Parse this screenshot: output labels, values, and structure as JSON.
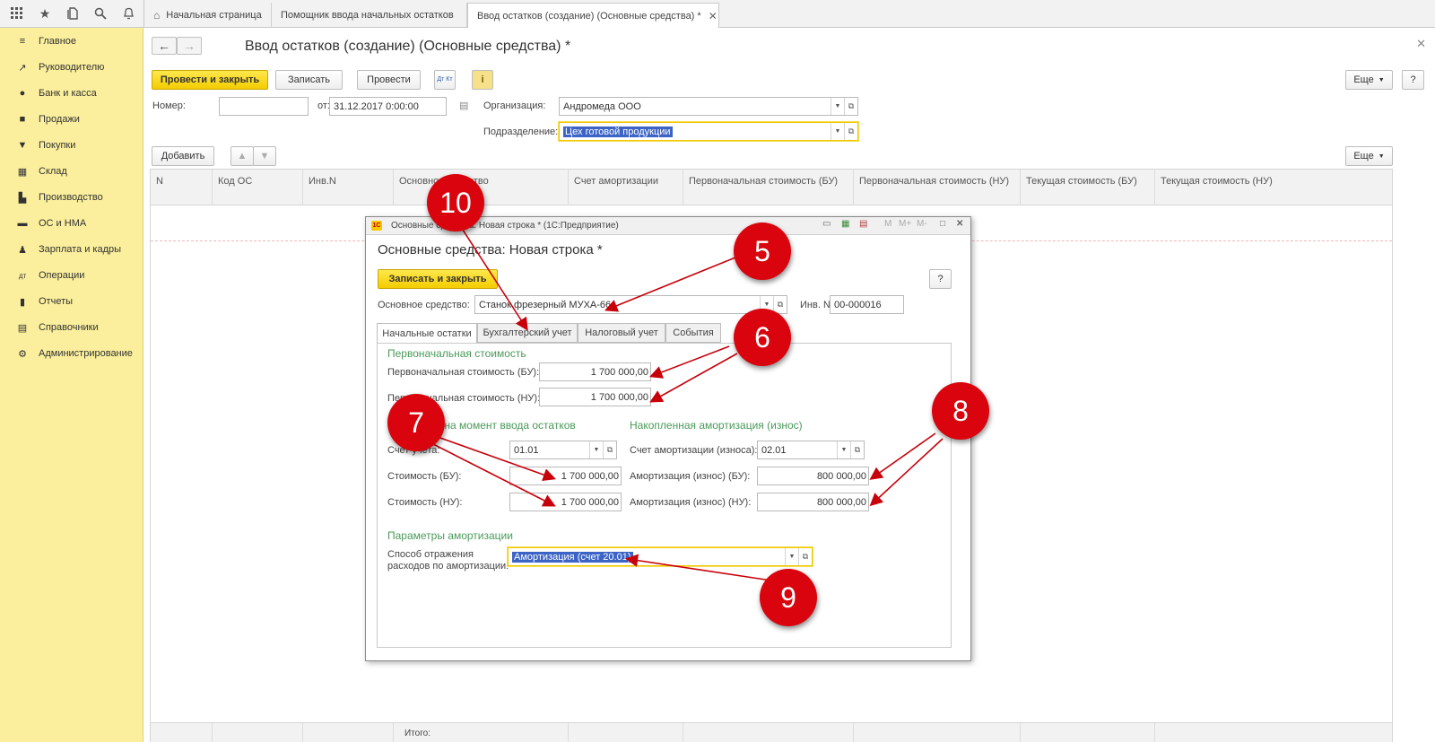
{
  "app": {
    "top_icons": [
      "apps-grid-icon",
      "star-icon",
      "history-icon",
      "search-icon",
      "bell-icon"
    ],
    "tabs": [
      {
        "label": "Начальная страница"
      },
      {
        "label": "Помощник ввода начальных остатков"
      },
      {
        "label": "Ввод остатков (создание) (Основные средства) *"
      }
    ],
    "tab_close": "✕"
  },
  "sidebar": {
    "items": [
      {
        "label": "Главное",
        "icon": "menu-icon"
      },
      {
        "label": "Руководителю",
        "icon": "trend-icon"
      },
      {
        "label": "Банк и касса",
        "icon": "ruble-icon"
      },
      {
        "label": "Продажи",
        "icon": "bag-icon"
      },
      {
        "label": "Покупки",
        "icon": "cart-icon"
      },
      {
        "label": "Склад",
        "icon": "warehouse-icon"
      },
      {
        "label": "Производство",
        "icon": "factory-icon"
      },
      {
        "label": "ОС и НМА",
        "icon": "truck-icon"
      },
      {
        "label": "Зарплата и кадры",
        "icon": "person-icon"
      },
      {
        "label": "Операции",
        "icon": "dt-kt-icon"
      },
      {
        "label": "Отчеты",
        "icon": "chart-icon"
      },
      {
        "label": "Справочники",
        "icon": "book-icon"
      },
      {
        "label": "Администрирование",
        "icon": "gear-icon"
      }
    ]
  },
  "form": {
    "title": "Ввод остатков (создание) (Основные средства) *",
    "toolbar": {
      "post_close": "Провести и закрыть",
      "save": "Записать",
      "post": "Провести",
      "dtkt": "Дт Кт",
      "info": "i",
      "more": "Еще",
      "help": "?"
    },
    "number_label": "Номер:",
    "number_value": "",
    "date_label": "от:",
    "date_value": "31.12.2017  0:00:00",
    "org_label": "Организация:",
    "org_value": "Андромеда ООО",
    "dept_label": "Подразделение:",
    "dept_value": "Цех готовой продукции",
    "add_button": "Добавить",
    "more2": "Еще",
    "table": {
      "columns": [
        "N",
        "Код ОС",
        "Инв.N",
        "Основное средство",
        "Счет амортизации",
        "Первоначальная стоимость (БУ)",
        "Первоначальная стоимость (НУ)",
        "Текущая стоимость (БУ)",
        "Текущая стоимость (НУ)"
      ],
      "footer": "Итого:"
    }
  },
  "dialog": {
    "window_title": "Основные средства: Новая строка * (1С:Предприятие)",
    "heading": "Основные средства: Новая строка *",
    "toolbar_icons": [
      "print-icon",
      "calc-icon",
      "calendar-icon"
    ],
    "memory": [
      "M",
      "M+",
      "M-"
    ],
    "save_close": "Записать и закрыть",
    "help": "?",
    "asset_label": "Основное средство:",
    "asset_value": "Станок фрезерный МУХА-66",
    "inv_label": "Инв. №:",
    "inv_value": "00-000016",
    "tabs": [
      "Начальные остатки",
      "Бухгалтерский учет",
      "Налоговый учет",
      "События"
    ],
    "initial_cost": {
      "section": "Первоначальная стоимость",
      "bu_label": "Первоначальная стоимость (БУ):",
      "bu_value": "1 700 000,00",
      "nu_label": "Первоначальная стоимость (НУ):",
      "nu_value": "1 700 000,00"
    },
    "cost_at_entry": {
      "section": "Стоимость на момент ввода остатков",
      "account_label": "Счет учета:",
      "account_value": "01.01",
      "bu_label": "Стоимость (БУ):",
      "bu_value": "1 700 000,00",
      "nu_label": "Стоимость (НУ):",
      "nu_value": "1 700 000,00"
    },
    "depreciation": {
      "section": "Накопленная амортизация (износ)",
      "account_label": "Счет амортизации (износа):",
      "account_value": "02.01",
      "bu_label": "Амортизация (износ) (БУ):",
      "bu_value": "800 000,00",
      "nu_label": "Амортизация (износ) (НУ):",
      "nu_value": "800 000,00"
    },
    "params": {
      "section": "Параметры амортизации",
      "method_label_1": "Способ отражения",
      "method_label_2": "расходов по амортизации:",
      "method_value": "Амортизация (счет 20.01)"
    }
  },
  "annotations": {
    "numbers": [
      "10",
      "5",
      "6",
      "7",
      "8",
      "9"
    ],
    "color": "#d9040d"
  }
}
